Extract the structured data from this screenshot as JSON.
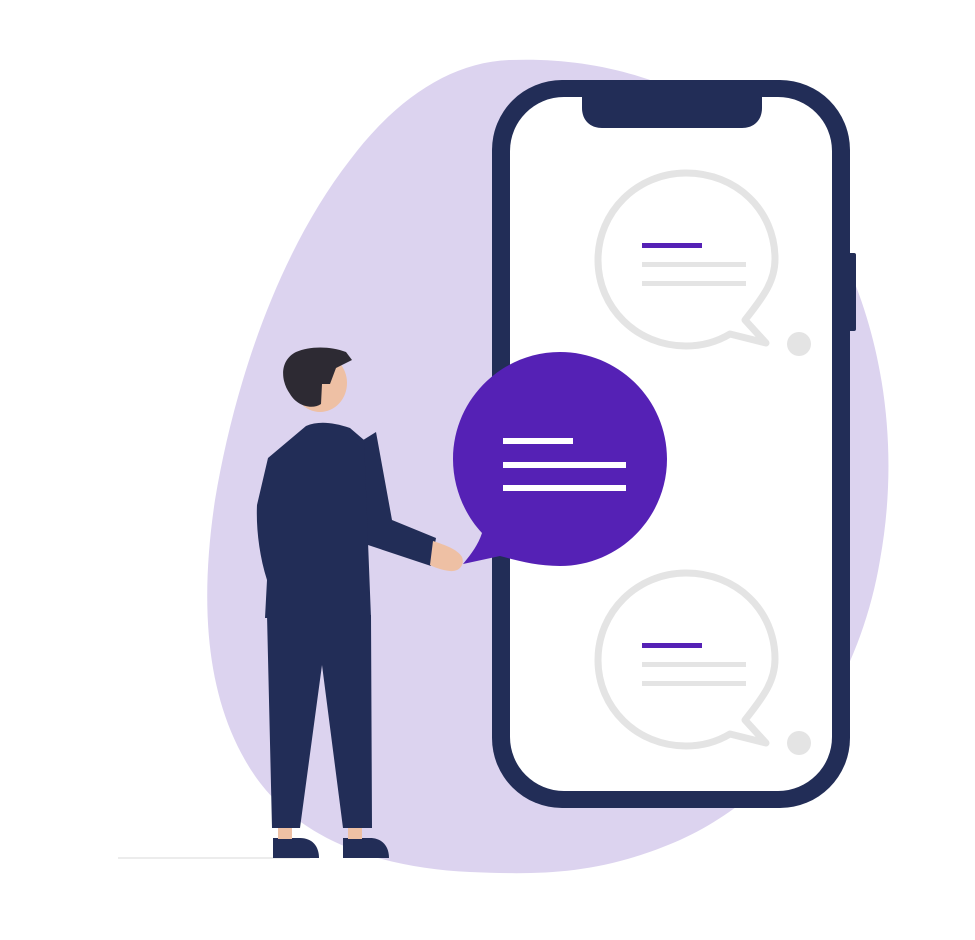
{
  "colors": {
    "background": "#ffffff",
    "blob": "#dcd3ef",
    "navy": "#222d57",
    "purple": "#5521b5",
    "bubble_gray": "#e4e4e4",
    "skin": "#eec0a4",
    "hair": "#2d2a33",
    "screen": "#ffffff",
    "ground": "#ececec"
  },
  "icons": [
    "chat-bubble-icon",
    "phone-illustration",
    "person-illustration"
  ]
}
